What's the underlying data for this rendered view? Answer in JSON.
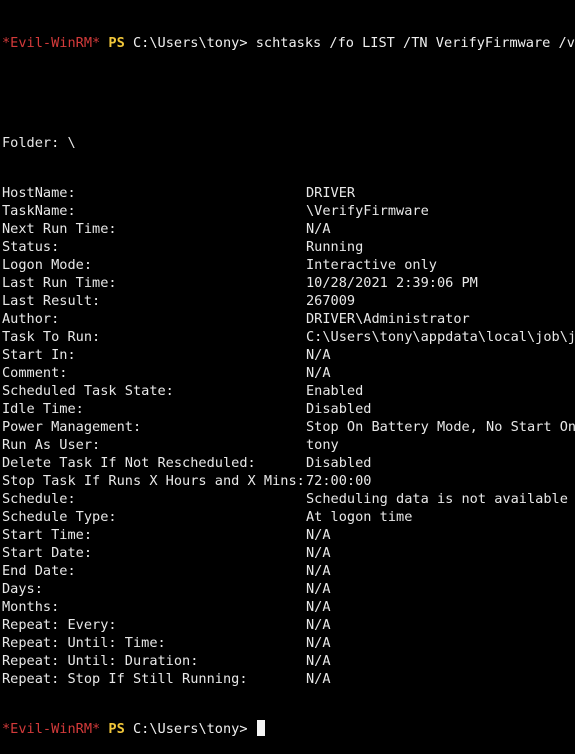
{
  "terminal": {
    "prompt": {
      "host": "*Evil-WinRM*",
      "ps": "PS",
      "path": "C:\\Users\\tony>"
    },
    "command": "schtasks /fo LIST /TN VerifyFirmware /v",
    "folder": "Folder: \\",
    "rows": [
      {
        "key": "HostName:",
        "value": "DRIVER"
      },
      {
        "key": "TaskName:",
        "value": "\\VerifyFirmware"
      },
      {
        "key": "Next Run Time:",
        "value": "N/A"
      },
      {
        "key": "Status:",
        "value": "Running"
      },
      {
        "key": "Logon Mode:",
        "value": "Interactive only"
      },
      {
        "key": "Last Run Time:",
        "value": "10/28/2021 2:39:06 PM"
      },
      {
        "key": "Last Result:",
        "value": "267009"
      },
      {
        "key": "Author:",
        "value": "DRIVER\\Administrator"
      },
      {
        "key": "Task To Run:",
        "value": "C:\\Users\\tony\\appdata\\local\\job\\jo"
      },
      {
        "key": "Start In:",
        "value": "N/A"
      },
      {
        "key": "Comment:",
        "value": "N/A"
      },
      {
        "key": "Scheduled Task State:",
        "value": "Enabled"
      },
      {
        "key": "Idle Time:",
        "value": "Disabled"
      },
      {
        "key": "Power Management:",
        "value": "Stop On Battery Mode, No Start On"
      },
      {
        "key": "Run As User:",
        "value": "tony"
      },
      {
        "key": "Delete Task If Not Rescheduled:",
        "value": "Disabled"
      },
      {
        "key": "Stop Task If Runs X Hours and X Mins:",
        "value": "72:00:00"
      },
      {
        "key": "Schedule:",
        "value": "Scheduling data is not available i"
      },
      {
        "key": "Schedule Type:",
        "value": "At logon time"
      },
      {
        "key": "Start Time:",
        "value": "N/A"
      },
      {
        "key": "Start Date:",
        "value": "N/A"
      },
      {
        "key": "End Date:",
        "value": "N/A"
      },
      {
        "key": "Days:",
        "value": "N/A"
      },
      {
        "key": "Months:",
        "value": "N/A"
      },
      {
        "key": "Repeat: Every:",
        "value": "N/A"
      },
      {
        "key": "Repeat: Until: Time:",
        "value": "N/A"
      },
      {
        "key": "Repeat: Until: Duration:",
        "value": "N/A"
      },
      {
        "key": "Repeat: Stop If Still Running:",
        "value": "N/A"
      }
    ]
  },
  "colors": {
    "background": "#000000",
    "prompt_host": "#d33a3a",
    "prompt_ps": "#f2c73a",
    "text": "#e8e8e8"
  }
}
